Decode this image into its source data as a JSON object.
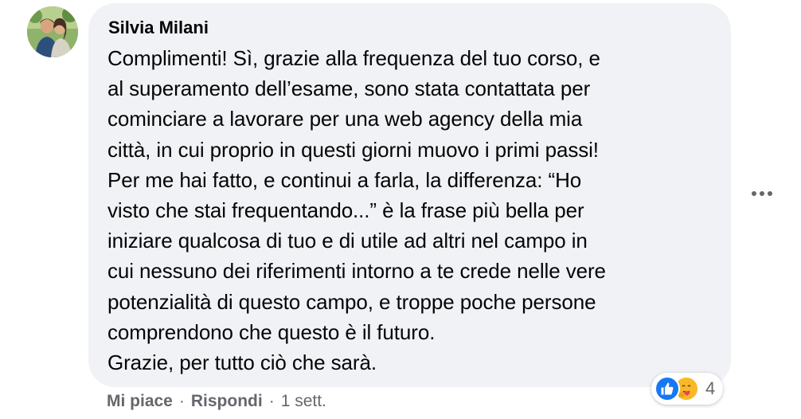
{
  "comment": {
    "author": "Silvia Milani",
    "lines": [
      "Complimenti! Sì, grazie alla frequenza del tuo corso, e",
      "al superamento dell’esame, sono stata contattata per",
      "cominciare a lavorare per una web agency della mia",
      "città, in cui proprio in questi giorni muovo i primi passi!",
      "Per me hai fatto, e continui a farla, la differenza: “Ho",
      "visto che stai frequentando...” è la frase più bella per",
      "iniziare qualcosa di tuo e di utile ad altri nel campo in",
      "cui nessuno dei riferimenti intorno a te crede nelle vere",
      "potenzialità di questo campo, e troppe poche persone",
      "comprendono che questo è il futuro.",
      "Grazie, per tutto ciò che sarà."
    ],
    "reactions": {
      "types": [
        "like-icon",
        "care-icon"
      ],
      "count": "4",
      "colors": {
        "like": "#1877f2",
        "care": "#f7b928"
      }
    },
    "actions": {
      "like_label": "Mi piace",
      "reply_label": "Rispondi",
      "separator": "·",
      "timestamp": "1 sett."
    }
  },
  "theme": {
    "bubble_bg": "#f0f2f5",
    "text_color": "#050505",
    "secondary_text": "#65676b"
  }
}
